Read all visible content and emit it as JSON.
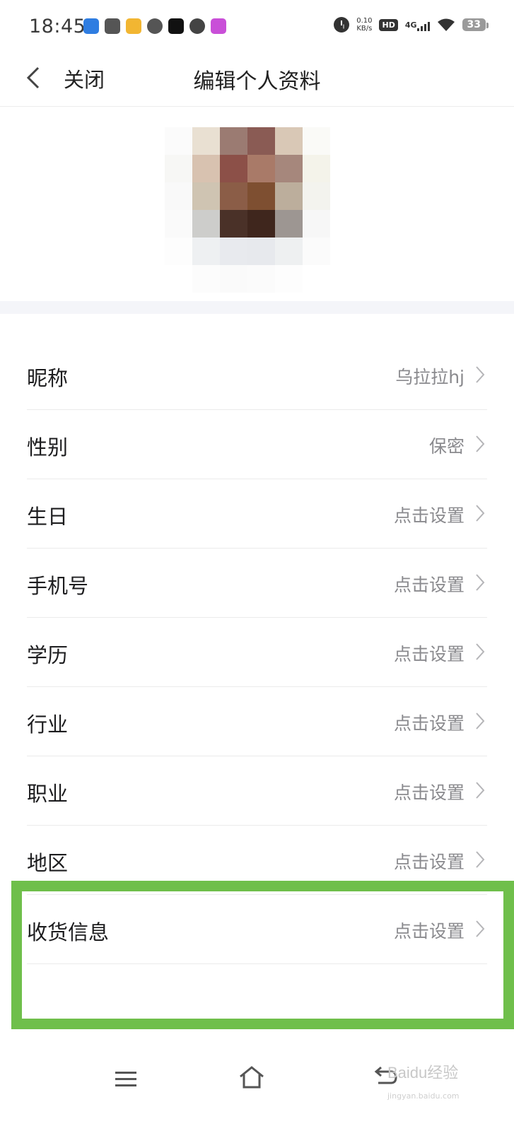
{
  "status_bar": {
    "time": "18:45",
    "app_icons": [
      "stock-app-icon",
      "xiaohongshu-icon",
      "weibo-icon",
      "cloud-icon",
      "tiktok-icon",
      "message-icon",
      "app-j-icon"
    ],
    "net_speed_value": "0.10",
    "net_speed_unit": "KB/s",
    "hd": "HD",
    "network": "4G",
    "battery": "33"
  },
  "nav": {
    "close_label": "关闭",
    "title": "编辑个人资料"
  },
  "profile_items": [
    {
      "label": "昵称",
      "value": "乌拉拉hj"
    },
    {
      "label": "性别",
      "value": "保密"
    },
    {
      "label": "生日",
      "value": "点击设置"
    },
    {
      "label": "手机号",
      "value": "点击设置"
    },
    {
      "label": "学历",
      "value": "点击设置"
    },
    {
      "label": "行业",
      "value": "点击设置"
    },
    {
      "label": "职业",
      "value": "点击设置"
    },
    {
      "label": "地区",
      "value": "点击设置"
    },
    {
      "label": "收货信息",
      "value": "点击设置"
    }
  ],
  "watermark": {
    "text": "Baidu经验",
    "sub": "jingyan.baidu.com"
  },
  "colors": {
    "highlight": "#6fbf4b",
    "divider_bg": "#f4f5f9",
    "value_text": "#8a8a8e"
  }
}
